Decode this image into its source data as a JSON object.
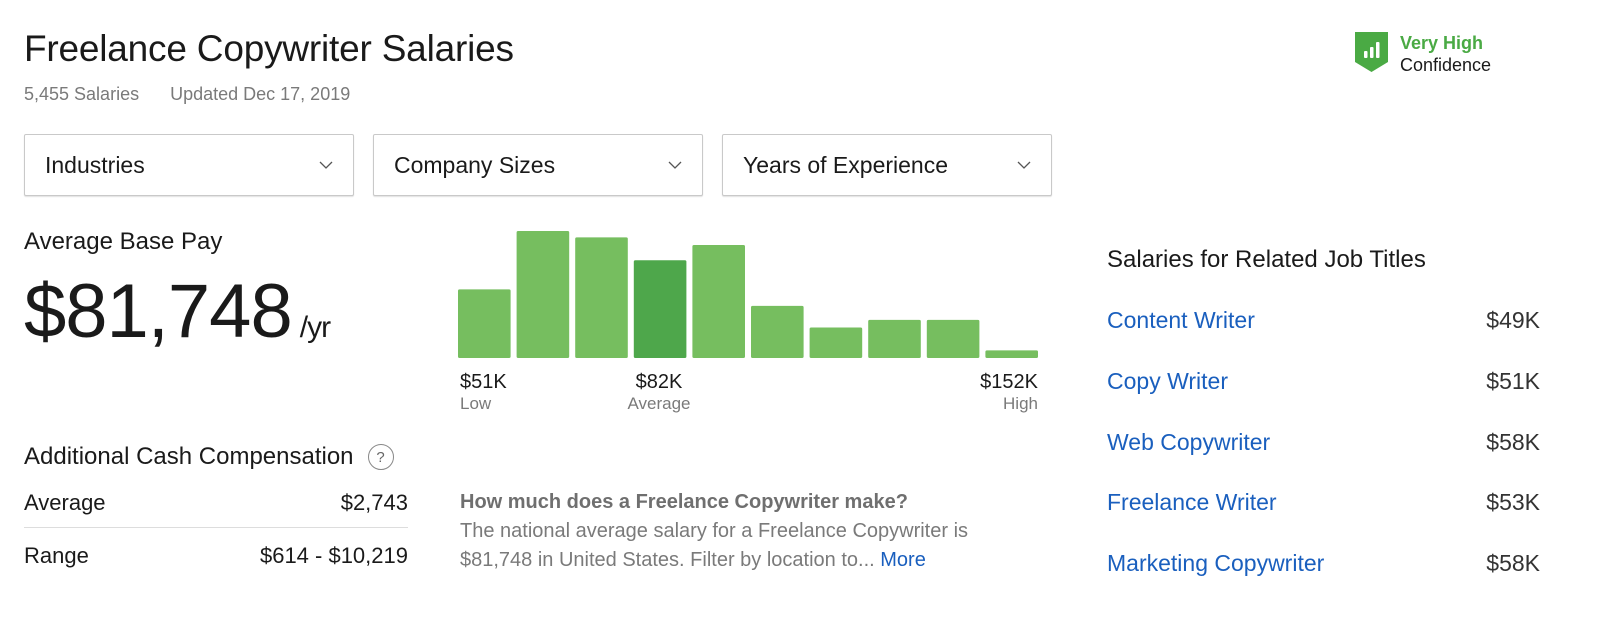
{
  "header": {
    "title": "Freelance Copywriter Salaries",
    "salary_count": "5,455 Salaries",
    "updated": "Updated Dec 17, 2019"
  },
  "confidence": {
    "level": "Very High",
    "label": "Confidence",
    "icon": "shield-bar-chart-icon",
    "color": "#4aaa44"
  },
  "filters": [
    {
      "label": "Industries"
    },
    {
      "label": "Company Sizes"
    },
    {
      "label": "Years of Experience"
    }
  ],
  "base_pay": {
    "label": "Average Base Pay",
    "value": "$81,748",
    "unit": "/yr"
  },
  "additional_cash": {
    "label": "Additional Cash Compensation",
    "help_icon": "question-circle-icon",
    "rows": [
      {
        "label": "Average",
        "value": "$2,743"
      },
      {
        "label": "Range",
        "value": "$614 - $10,219"
      }
    ]
  },
  "chart_data": {
    "type": "bar",
    "title": "",
    "xlabel": "",
    "ylabel": "",
    "categories": [
      "1",
      "2",
      "3",
      "4",
      "5",
      "6",
      "7",
      "8",
      "9",
      "10"
    ],
    "values": [
      54,
      100,
      95,
      77,
      89,
      41,
      24,
      30,
      30,
      6
    ],
    "highlight_index": 3,
    "bar_color": "#76be5f",
    "highlight_color": "#4ea74b",
    "ylim": [
      0,
      100
    ],
    "grid": false,
    "markers": {
      "low": {
        "value": "$51K",
        "label": "Low"
      },
      "average": {
        "value": "$82K",
        "label": "Average"
      },
      "high": {
        "value": "$152K",
        "label": "High"
      }
    }
  },
  "faq": {
    "question": "How much does a Freelance Copywriter make?",
    "answer": "The national average salary for a Freelance Copywriter is $81,748 in United States. Filter by location to...",
    "more_link": "More"
  },
  "related": {
    "title": "Salaries for Related Job Titles",
    "items": [
      {
        "title": "Content Writer",
        "salary": "$49K"
      },
      {
        "title": "Copy Writer",
        "salary": "$51K"
      },
      {
        "title": "Web Copywriter",
        "salary": "$58K"
      },
      {
        "title": "Freelance Writer",
        "salary": "$53K"
      },
      {
        "title": "Marketing Copywriter",
        "salary": "$58K"
      }
    ]
  }
}
